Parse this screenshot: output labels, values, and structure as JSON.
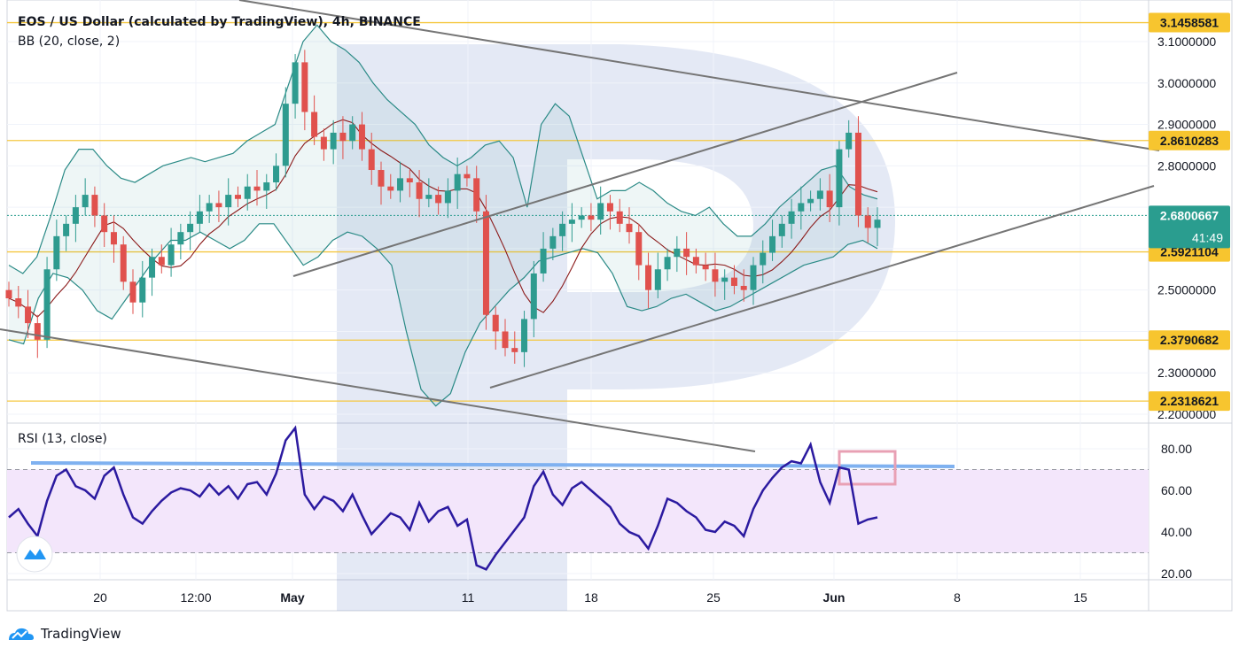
{
  "header": {
    "title": "EOS / US Dollar (calculated by TradingView), 4h, BINANCE",
    "indicator": "BB (20, close, 2)"
  },
  "rsi_panel": {
    "label": "RSI (13, close)"
  },
  "footer": {
    "brand": "TradingView"
  },
  "colors": {
    "level_line": "#f5c842",
    "level_tag": "#f7c52f",
    "rsi_line": "#2b1aa0",
    "rsi_fill": "#f3e6fb",
    "resistance_line": "#7fb1f0",
    "highlight_box": "#e8a0b4",
    "trend_line": "#757575",
    "bb_band": "#2a8a86",
    "bb_mid": "#8b1a1a",
    "candle_up": "#2e9b8f",
    "candle_down": "#e0514d",
    "current_price_tag": "#2a9d8f"
  },
  "chart_data": [
    {
      "type": "candlestick",
      "title": "EOS / US Dollar (calculated by TradingView), 4h, BINANCE",
      "x_ticks": [
        "20",
        "12:00",
        "May",
        "11",
        "18",
        "25",
        "Jun",
        "8",
        "15"
      ],
      "y_ticks": [
        "2.2000000",
        "2.3000000",
        "2.5000000",
        "2.8000000",
        "2.9000000",
        "3.0000000",
        "3.1000000"
      ],
      "ylim": [
        2.19,
        3.15
      ],
      "levels": [
        {
          "label": "3.1458581",
          "value": 3.1458581
        },
        {
          "label": "2.8610283",
          "value": 2.8610283
        },
        {
          "label": "2.5921104",
          "value": 2.5921104
        },
        {
          "label": "2.3790682",
          "value": 2.3790682
        },
        {
          "label": "2.2318621",
          "value": 2.2318621
        }
      ],
      "current_price": {
        "label": "2.6800667",
        "value": 2.6800667,
        "countdown": "41:49"
      },
      "close_series": [
        2.48,
        2.46,
        2.42,
        2.38,
        2.55,
        2.63,
        2.66,
        2.7,
        2.73,
        2.68,
        2.64,
        2.61,
        2.52,
        2.47,
        2.53,
        2.58,
        2.56,
        2.61,
        2.64,
        2.66,
        2.69,
        2.71,
        2.7,
        2.73,
        2.72,
        2.75,
        2.74,
        2.76,
        2.8,
        2.95,
        3.05,
        2.93,
        2.87,
        2.84,
        2.88,
        2.86,
        2.9,
        2.84,
        2.79,
        2.75,
        2.74,
        2.77,
        2.76,
        2.72,
        2.73,
        2.71,
        2.74,
        2.78,
        2.77,
        2.69,
        2.44,
        2.4,
        2.36,
        2.35,
        2.43,
        2.54,
        2.6,
        2.63,
        2.66,
        2.67,
        2.68,
        2.67,
        2.71,
        2.69,
        2.66,
        2.64,
        2.56,
        2.5,
        2.55,
        2.58,
        2.6,
        2.58,
        2.56,
        2.55,
        2.52,
        2.53,
        2.51,
        2.5,
        2.56,
        2.59,
        2.63,
        2.66,
        2.69,
        2.71,
        2.72,
        2.74,
        2.7,
        2.84,
        2.88,
        2.68,
        2.65,
        2.67
      ],
      "bb_upper": [
        2.56,
        2.54,
        2.58,
        2.68,
        2.79,
        2.84,
        2.84,
        2.8,
        2.77,
        2.76,
        2.78,
        2.8,
        2.81,
        2.82,
        2.81,
        2.82,
        2.83,
        2.86,
        2.88,
        2.9,
        3.0,
        3.1,
        3.14,
        3.1,
        3.08,
        3.05,
        3.0,
        2.96,
        2.93,
        2.9,
        2.85,
        2.82,
        2.8,
        2.82,
        2.85,
        2.86,
        2.82,
        2.7,
        2.9,
        2.95,
        2.92,
        2.82,
        2.72,
        2.74,
        2.74,
        2.76,
        2.74,
        2.71,
        2.69,
        2.68,
        2.7,
        2.66,
        2.63,
        2.63,
        2.66,
        2.7,
        2.73,
        2.76,
        2.79,
        2.8,
        2.75,
        2.73,
        2.72
      ],
      "bb_lower": [
        2.38,
        2.37,
        2.48,
        2.54,
        2.53,
        2.5,
        2.45,
        2.43,
        2.48,
        2.53,
        2.58,
        2.62,
        2.62,
        2.64,
        2.62,
        2.6,
        2.62,
        2.66,
        2.66,
        2.61,
        2.56,
        2.58,
        2.62,
        2.64,
        2.63,
        2.6,
        2.56,
        2.4,
        2.26,
        2.22,
        2.25,
        2.35,
        2.42,
        2.46,
        2.5,
        2.53,
        2.57,
        2.58,
        2.59,
        2.6,
        2.59,
        2.54,
        2.46,
        2.45,
        2.46,
        2.48,
        2.49,
        2.47,
        2.45,
        2.46,
        2.48,
        2.5,
        2.52,
        2.54,
        2.56,
        2.57,
        2.58,
        2.61,
        2.62,
        2.6
      ],
      "rsi": {
        "label": "RSI (13, close)",
        "ticks": [
          "80.00",
          "60.00",
          "40.00",
          "20.00"
        ],
        "ylim": [
          18,
          88
        ],
        "bands": [
          70,
          30
        ],
        "values": [
          47,
          51,
          44,
          38,
          55,
          67,
          70,
          62,
          60,
          56,
          67,
          71,
          58,
          47,
          44,
          50,
          55,
          59,
          61,
          60,
          57,
          63,
          58,
          62,
          56,
          63,
          64,
          58,
          68,
          84,
          90,
          58,
          51,
          57,
          55,
          50,
          58,
          48,
          39,
          44,
          49,
          47,
          41,
          54,
          45,
          50,
          52,
          43,
          46,
          24,
          22,
          29,
          35,
          41,
          47,
          62,
          69,
          58,
          53,
          61,
          64,
          60,
          56,
          52,
          44,
          40,
          38,
          32,
          43,
          56,
          54,
          50,
          47,
          41,
          40,
          45,
          43,
          38,
          51,
          60,
          66,
          71,
          74,
          73,
          82,
          64,
          54,
          71,
          70,
          44,
          46,
          47
        ]
      }
    }
  ]
}
